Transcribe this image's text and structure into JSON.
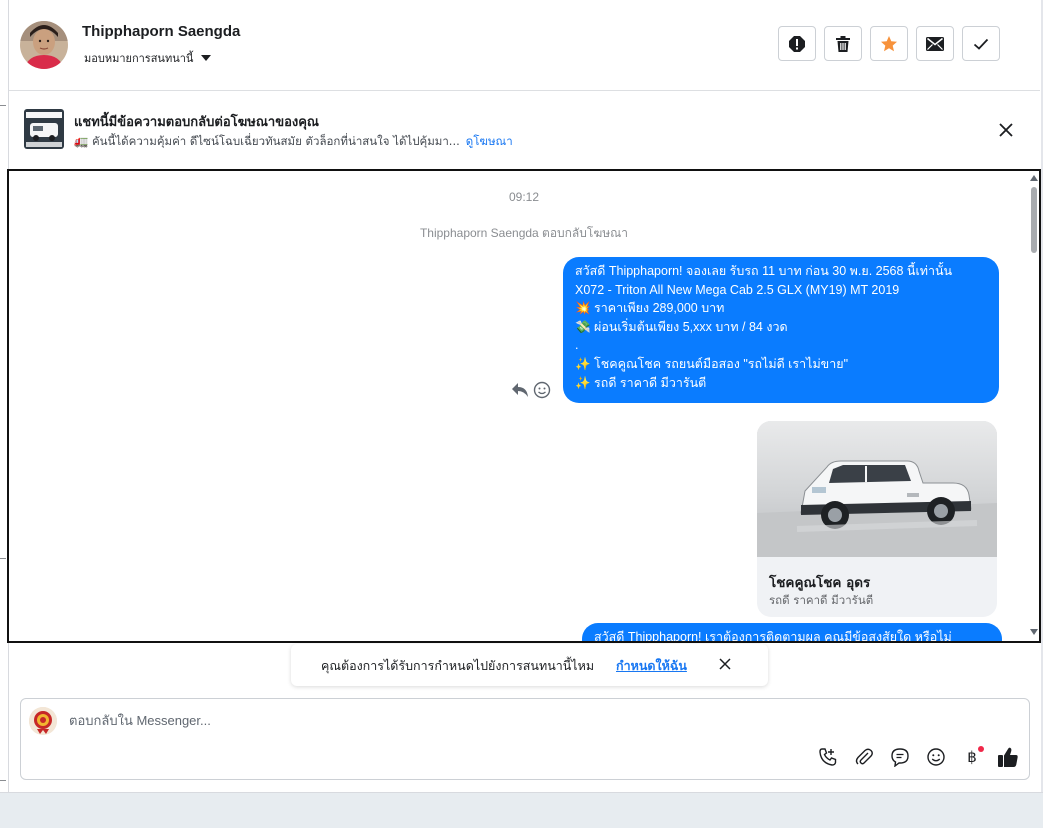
{
  "header": {
    "contact_name": "Thipphaporn Saengda",
    "assign_label": "มอบหมายการสนทนานี้",
    "actions": [
      "spam-icon",
      "trash-icon",
      "star-icon",
      "mail-icon",
      "check-icon"
    ],
    "star_color": "#f7923b"
  },
  "ad_banner": {
    "title": "แชทนี้มีข้อความตอบกลับต่อโฆษณาของคุณ",
    "subtitle": "🚛 คันนี้ได้ความคุ้มค่า ดีไซน์โฉบเฉี่ยวทันสมัย ตัวล็อกที่น่าสนใจ ได้ไปคุ้มมา...",
    "link": "ดูโฆษณา"
  },
  "conversation": {
    "time": "09:12",
    "reply_note": "Thipphaporn Saengda ตอบกลับโฆษณา",
    "message1_lines": [
      "สวัสดี Thipphaporn! จองเลย รับรถ 11 บาท ก่อน 30 พ.ย. 2568 นี้เท่านั้น",
      "X072 - Triton All New Mega Cab 2.5 GLX (MY19) MT 2019",
      "💥 ราคาเพียง 289,000 บาท",
      "💸 ผ่อนเริ่มต้นเพียง 5,xxx บาท / 84 งวด",
      ".",
      "✨ โชคคูณโชค รถยนต์มือสอง \"รถไม่ดี เราไม่ขาย\"",
      "✨ รถดี ราคาดี มีวารันตี"
    ],
    "card": {
      "title": "โชคคูณโชค อุดร",
      "subtitle": "รถดี ราคาดี มีวารันตี"
    },
    "message2_preview": "สวัสดี Thipphaporn! เราต้องการติดตามผล คุณมีข้อสงสัยใด หรือไม่",
    "bubble_color": "#0a7cff"
  },
  "reminder": {
    "text": "คุณต้องการได้รับการกำหนดไปยังการสนทนานี้ไหม",
    "link": "กำหนดให้ฉัน"
  },
  "composer": {
    "placeholder": "ตอบกลับใน Messenger...",
    "tools": [
      "call-icon",
      "attach-icon",
      "saved-reply-icon",
      "emoji-icon",
      "baht-icon",
      "like-icon"
    ],
    "baht_symbol": "฿"
  }
}
